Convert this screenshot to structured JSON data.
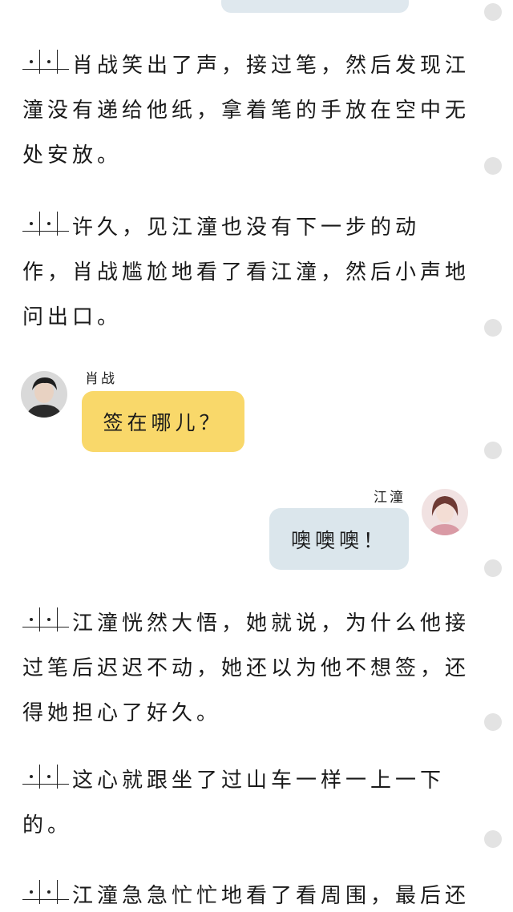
{
  "paragraphs": [
    {
      "lines": [
        "肖战笑出了声，接过笔，然后发现江",
        "潼没有递给他纸，拿着笔的手放在空中无",
        "处安放。"
      ]
    },
    {
      "lines": [
        "许久，见江潼也没有下一步的动",
        "作，肖战尴尬地看了看江潼，然后小声地",
        "问出口。"
      ]
    },
    {
      "lines": [
        "江潼恍然大悟，她就说，为什么他接",
        "过笔后迟迟不动，她还以为他不想签，还",
        "得她担心了好久。"
      ]
    },
    {
      "lines": [
        "这心就跟坐了过山车一样一上一下",
        "的。"
      ]
    },
    {
      "lines": [
        "江潼急急忙忙地看了看周围，最后还"
      ]
    }
  ],
  "chat": {
    "left": {
      "speaker": "肖战",
      "message": "签在哪儿？",
      "avatar": "male-avatar-icon",
      "bubble_color": "#f9d86a"
    },
    "right": {
      "speaker": "江潼",
      "message": "噢噢噢！",
      "avatar": "female-avatar-icon",
      "bubble_color": "#dbe6ec"
    }
  },
  "colors": {
    "background": "#ffffff",
    "text": "#1a1a1a",
    "scroll_dot": "#e3e3e3"
  }
}
